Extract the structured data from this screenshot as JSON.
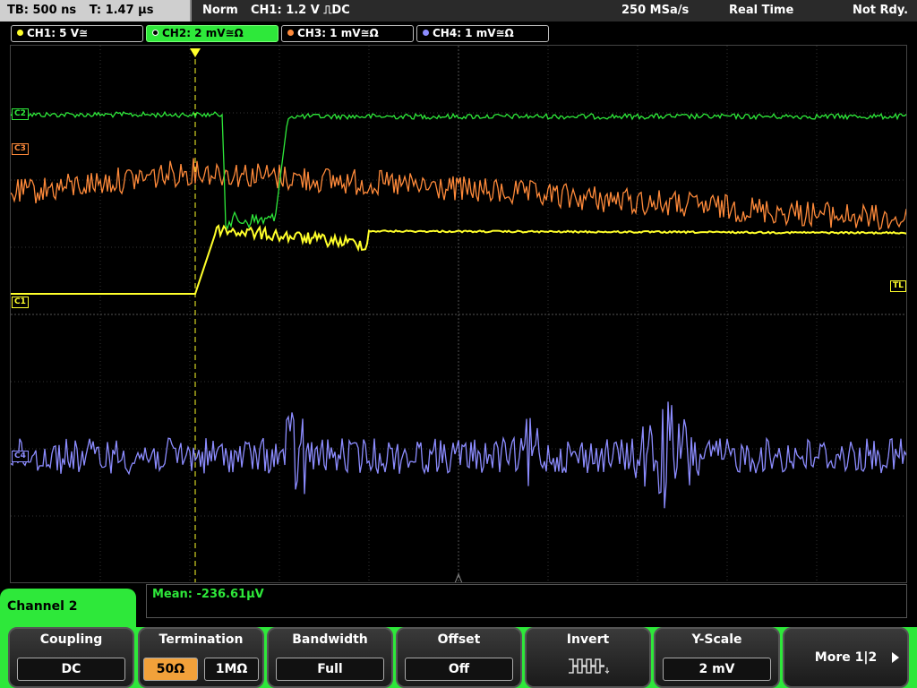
{
  "top": {
    "tb": "TB: 500 ns",
    "t": "T: 1.47 µs",
    "mode": "Norm",
    "trigger": "CH1: 1.2 V ⎍DC",
    "sample_rate": "250 MSa/s",
    "acq": "Real Time",
    "status": "Not Rdy."
  },
  "channels": [
    {
      "label": "CH1: 5 V≅",
      "color": "#ffff2a"
    },
    {
      "label": "CH2: 2 mV≅Ω",
      "color": "#2ee83a"
    },
    {
      "label": "CH3: 1 mV≅Ω",
      "color": "#ff8a3a"
    },
    {
      "label": "CH4: 1 mV≅Ω",
      "color": "#8c8cff"
    }
  ],
  "markers": {
    "c2": "C2",
    "c3": "C3",
    "c1": "C1",
    "c4": "C4",
    "tl": "TL",
    "trig": "T"
  },
  "measure": {
    "mean": "Mean: -236.61µV"
  },
  "menu": {
    "channel_title": "Channel 2",
    "coupling_label": "Coupling",
    "coupling_value": "DC",
    "termination_label": "Termination",
    "term_50": "50Ω",
    "term_1m": "1MΩ",
    "bandwidth_label": "Bandwidth",
    "bandwidth_value": "Full",
    "offset_label": "Offset",
    "offset_value": "Off",
    "invert_label": "Invert",
    "yscale_label": "Y-Scale",
    "yscale_value": "2 mV",
    "more_label": "More 1|2"
  }
}
